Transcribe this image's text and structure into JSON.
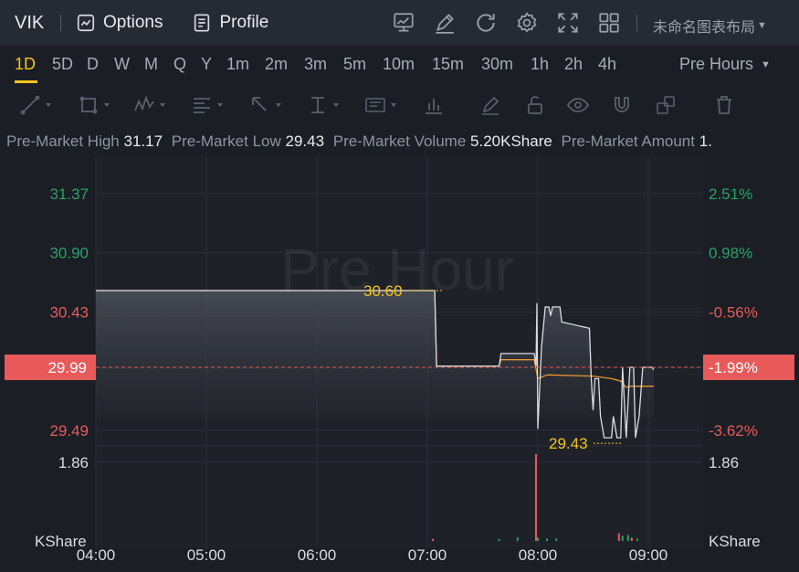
{
  "toolbar": {
    "symbol": "VIK",
    "options_label": "Options",
    "profile_label": "Profile",
    "layout_name": "未命名图表布局"
  },
  "intervals": {
    "items": [
      "1D",
      "5D",
      "D",
      "W",
      "M",
      "Q",
      "Y",
      "1m",
      "2m",
      "3m",
      "5m",
      "10m",
      "15m",
      "30m",
      "1h",
      "2h",
      "4h"
    ],
    "active": "1D",
    "session_select": "Pre Hours"
  },
  "info": {
    "high_label": "Pre-Market High",
    "high_value": "31.17",
    "low_label": "Pre-Market Low",
    "low_value": "29.43",
    "volume_label": "Pre-Market Volume",
    "volume_value": "5.20KShare",
    "amount_label": "Pre-Market Amount",
    "amount_value": "1."
  },
  "colors": {
    "up": "#26a269",
    "down": "#e85a5a",
    "accent": "#f5c518",
    "price_line": "#d9dce3",
    "avg_line": "#e8962e",
    "marker": "#f5c518"
  },
  "chart_data": {
    "type": "line",
    "watermark": "Pre Hour",
    "x_ticks": [
      "04:00",
      "05:00",
      "06:00",
      "07:00",
      "08:00",
      "09:00"
    ],
    "price_axis_left": [
      "31.37",
      "30.90",
      "30.43",
      "29.99",
      "29.49"
    ],
    "price_axis_right": [
      "2.51%",
      "0.98%",
      "-0.56%",
      "-1.99%",
      "-3.62%"
    ],
    "current_price": "29.99",
    "current_change": "-1.99%",
    "high_marker": "30.60",
    "low_marker": "29.43",
    "volume_axis_left": [
      "1.86",
      "KShare"
    ],
    "volume_axis_right": [
      "1.86",
      "KShare"
    ],
    "ylim": [
      29.3,
      31.37
    ],
    "price_series": [
      [
        "04:00",
        30.6
      ],
      [
        "07:04",
        30.6
      ],
      [
        "07:05",
        30.0
      ],
      [
        "07:39",
        30.0
      ],
      [
        "07:40",
        30.1
      ],
      [
        "07:58",
        30.1
      ],
      [
        "07:59",
        30.0
      ],
      [
        "07:59.5",
        30.5
      ],
      [
        "08:00",
        29.5
      ],
      [
        "08:02",
        30.15
      ],
      [
        "08:04",
        30.47
      ],
      [
        "08:06",
        30.47
      ],
      [
        "08:07",
        30.4
      ],
      [
        "08:08",
        30.47
      ],
      [
        "08:12",
        30.47
      ],
      [
        "08:13",
        30.35
      ],
      [
        "08:28",
        30.3
      ],
      [
        "08:29",
        29.9
      ],
      [
        "08:30",
        29.65
      ],
      [
        "08:31",
        29.9
      ],
      [
        "08:33",
        29.9
      ],
      [
        "08:34",
        29.6
      ],
      [
        "08:36",
        29.43
      ],
      [
        "08:40",
        29.43
      ],
      [
        "08:41",
        29.6
      ],
      [
        "08:43",
        29.43
      ],
      [
        "08:45",
        29.43
      ],
      [
        "08:46",
        29.99
      ],
      [
        "08:48",
        29.43
      ],
      [
        "08:50",
        29.99
      ],
      [
        "08:52",
        29.99
      ],
      [
        "08:53",
        29.43
      ],
      [
        "08:55",
        29.6
      ],
      [
        "08:57",
        29.99
      ],
      [
        "09:02",
        29.99
      ],
      [
        "09:03",
        29.97
      ]
    ],
    "avg_series": [
      [
        "04:00",
        30.6
      ],
      [
        "07:04",
        30.6
      ],
      [
        "07:05",
        30.0
      ],
      [
        "07:39",
        30.0
      ],
      [
        "07:40",
        30.05
      ],
      [
        "07:58",
        30.05
      ],
      [
        "08:00",
        29.9
      ],
      [
        "08:05",
        29.93
      ],
      [
        "08:30",
        29.92
      ],
      [
        "08:40",
        29.9
      ],
      [
        "08:45",
        29.88
      ],
      [
        "08:48",
        29.83
      ],
      [
        "08:50",
        29.84
      ],
      [
        "09:03",
        29.84
      ]
    ],
    "volume_bars": [
      {
        "t": "07:03",
        "v": 0.05,
        "c": "down"
      },
      {
        "t": "07:39",
        "v": 0.05,
        "c": "up"
      },
      {
        "t": "07:49",
        "v": 0.08,
        "c": "up"
      },
      {
        "t": "07:59",
        "v": 2.05,
        "c": "down"
      },
      {
        "t": "08:00",
        "v": 0.08,
        "c": "up"
      },
      {
        "t": "08:05",
        "v": 0.06,
        "c": "up"
      },
      {
        "t": "08:10",
        "v": 0.06,
        "c": "up"
      },
      {
        "t": "08:44",
        "v": 0.18,
        "c": "down"
      },
      {
        "t": "08:46",
        "v": 0.12,
        "c": "up"
      },
      {
        "t": "08:49",
        "v": 0.14,
        "c": "up"
      },
      {
        "t": "08:51",
        "v": 0.08,
        "c": "down"
      },
      {
        "t": "08:54",
        "v": 0.06,
        "c": "up"
      }
    ],
    "vol_max": 2.2
  }
}
